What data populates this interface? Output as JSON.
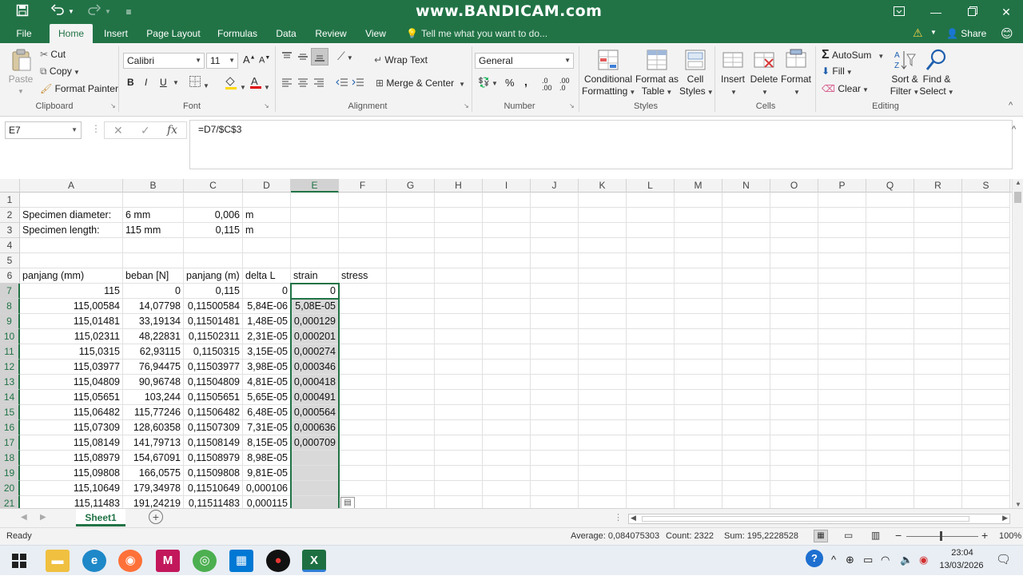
{
  "titlebar": {
    "watermark": "www.BANDICAM.com",
    "save_icon": "save-icon",
    "undo_icon": "undo-icon",
    "redo_icon": "redo-icon"
  },
  "tabs": [
    "File",
    "Home",
    "Insert",
    "Page Layout",
    "Formulas",
    "Data",
    "Review",
    "View"
  ],
  "tellme": "Tell me what you want to do...",
  "share": "Share",
  "ribbon": {
    "clipboard": {
      "label": "Clipboard",
      "paste": "Paste",
      "cut": "Cut",
      "copy": "Copy",
      "format_painter": "Format Painter"
    },
    "font": {
      "label": "Font",
      "name": "Calibri",
      "size": "11",
      "bold": "B",
      "italic": "I",
      "underline": "U"
    },
    "alignment": {
      "label": "Alignment",
      "wrap": "Wrap Text",
      "merge": "Merge & Center"
    },
    "number": {
      "label": "Number",
      "format": "General",
      "percent": "%",
      "comma": ","
    },
    "styles": {
      "label": "Styles",
      "cond1": "Conditional",
      "cond2": "Formatting",
      "fmt1": "Format as",
      "fmt2": "Table",
      "cell1": "Cell",
      "cell2": "Styles"
    },
    "cells": {
      "label": "Cells",
      "insert": "Insert",
      "delete": "Delete",
      "format": "Format"
    },
    "editing": {
      "label": "Editing",
      "autosum": "AutoSum",
      "fill": "Fill",
      "clear": "Clear",
      "sort1": "Sort &",
      "sort2": "Filter",
      "find1": "Find &",
      "find2": "Select"
    }
  },
  "namebox": "E7",
  "formula": "=D7/$C$3",
  "columns": [
    "A",
    "B",
    "C",
    "D",
    "E",
    "F",
    "G",
    "H",
    "I",
    "J",
    "K",
    "L",
    "M",
    "N",
    "O",
    "P",
    "Q",
    "R",
    "S"
  ],
  "rows": [
    "1",
    "2",
    "3",
    "4",
    "5",
    "6",
    "7",
    "8",
    "9",
    "10",
    "11",
    "12",
    "13",
    "14",
    "15",
    "16",
    "17",
    "18",
    "19",
    "20",
    "21"
  ],
  "cells": {
    "r2": [
      "Specimen diameter:",
      "6 mm",
      "0,006",
      "m"
    ],
    "r3": [
      "Specimen length:",
      "115 mm",
      "0,115",
      "m"
    ],
    "r6": [
      "panjang (mm)",
      "beban [N]",
      "panjang (m)",
      "delta L",
      "strain",
      "stress"
    ],
    "data": [
      [
        "115",
        "0",
        "0,115",
        "0",
        "0"
      ],
      [
        "115,00584",
        "14,07798",
        "0,11500584",
        "5,84E-06",
        "5,08E-05"
      ],
      [
        "115,01481",
        "33,19134",
        "0,11501481",
        "1,48E-05",
        "0,000129"
      ],
      [
        "115,02311",
        "48,22831",
        "0,11502311",
        "2,31E-05",
        "0,000201"
      ],
      [
        "115,0315",
        "62,93115",
        "0,1150315",
        "3,15E-05",
        "0,000274"
      ],
      [
        "115,03977",
        "76,94475",
        "0,11503977",
        "3,98E-05",
        "0,000346"
      ],
      [
        "115,04809",
        "90,96748",
        "0,11504809",
        "4,81E-05",
        "0,000418"
      ],
      [
        "115,05651",
        "103,244",
        "0,11505651",
        "5,65E-05",
        "0,000491"
      ],
      [
        "115,06482",
        "115,77246",
        "0,11506482",
        "6,48E-05",
        "0,000564"
      ],
      [
        "115,07309",
        "128,60358",
        "0,11507309",
        "7,31E-05",
        "0,000636"
      ],
      [
        "115,08149",
        "141,79713",
        "0,11508149",
        "8,15E-05",
        "0,000709"
      ],
      [
        "115,08979",
        "154,67091",
        "0,11508979",
        "8,98E-05",
        ""
      ],
      [
        "115,09808",
        "166,0575",
        "0,11509808",
        "9,81E-05",
        ""
      ],
      [
        "115,10649",
        "179,34978",
        "0,11510649",
        "0,000106",
        ""
      ],
      [
        "115,11483",
        "191,24219",
        "0,11511483",
        "0,000115",
        ""
      ]
    ]
  },
  "sheet_tab": "Sheet1",
  "status": {
    "ready": "Ready",
    "average": "Average: 0,084075303",
    "count": "Count: 2322",
    "sum": "Sum: 195,2228528",
    "zoom": "100%"
  },
  "taskbar": {
    "time": "23:04",
    "date": "13/03/2026"
  },
  "colors": {
    "accent": "#217346",
    "selection": "#d9d9d9"
  }
}
